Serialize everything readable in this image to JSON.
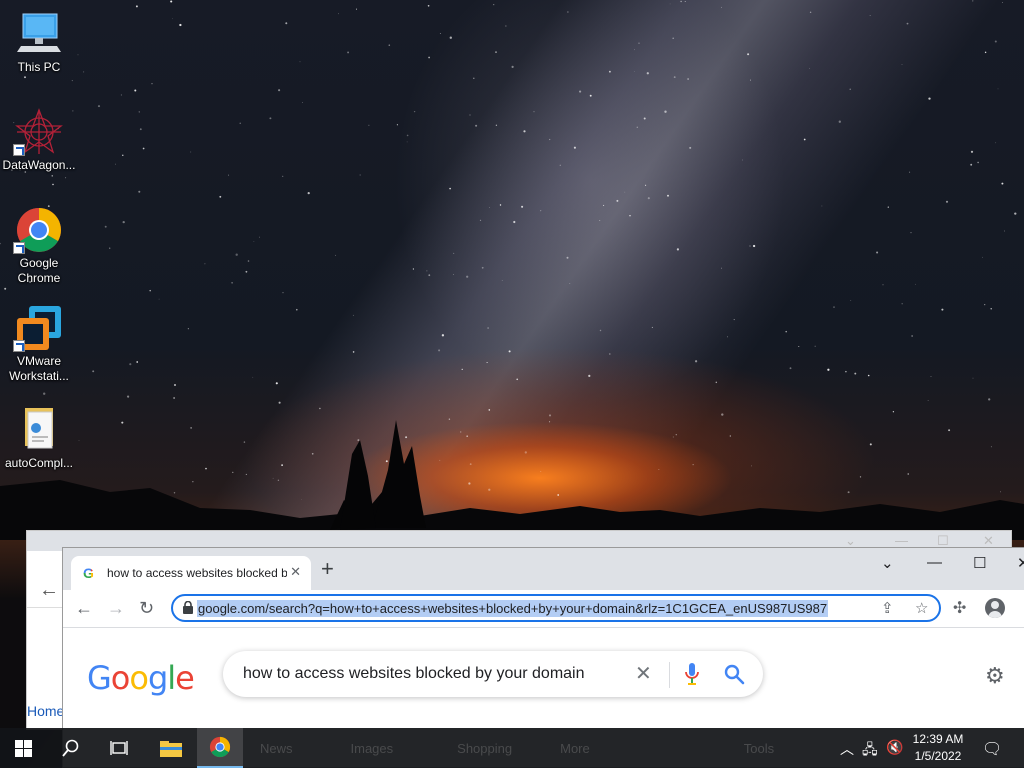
{
  "desktop": {
    "icons": [
      {
        "label": "This PC",
        "icon": "computer-icon"
      },
      {
        "label": "DataWagon...",
        "icon": "datawagon-icon"
      },
      {
        "label": "Google Chrome",
        "icon": "chrome-icon"
      },
      {
        "label": "VMware Workstati...",
        "icon": "vmware-icon"
      },
      {
        "label": "autoCompl...",
        "icon": "document-file-icon"
      }
    ]
  },
  "back_window": {
    "home_link": "Home"
  },
  "chrome": {
    "tab_title": "how to access websites blocked by your domain - Google Search",
    "new_tab_glyph": "+",
    "url": "google.com/search?q=how+to+access+websites+blocked+by+your+domain&rlz=1C1GCEA_enUS987US987",
    "search_query": "how to access websites blocked by your domain",
    "logo_letters": [
      "G",
      "o",
      "o",
      "g",
      "l",
      "e"
    ],
    "logo_colors": [
      "#4285f4",
      "#ea4335",
      "#fbbc05",
      "#4285f4",
      "#34a853",
      "#ea4335"
    ]
  },
  "taskbar": {
    "ghost_items": [
      "News",
      "Images",
      "Shopping",
      "More",
      "Tools"
    ],
    "time": "12:39 AM",
    "date": "1/5/2022",
    "accent": "#76b9ed"
  }
}
